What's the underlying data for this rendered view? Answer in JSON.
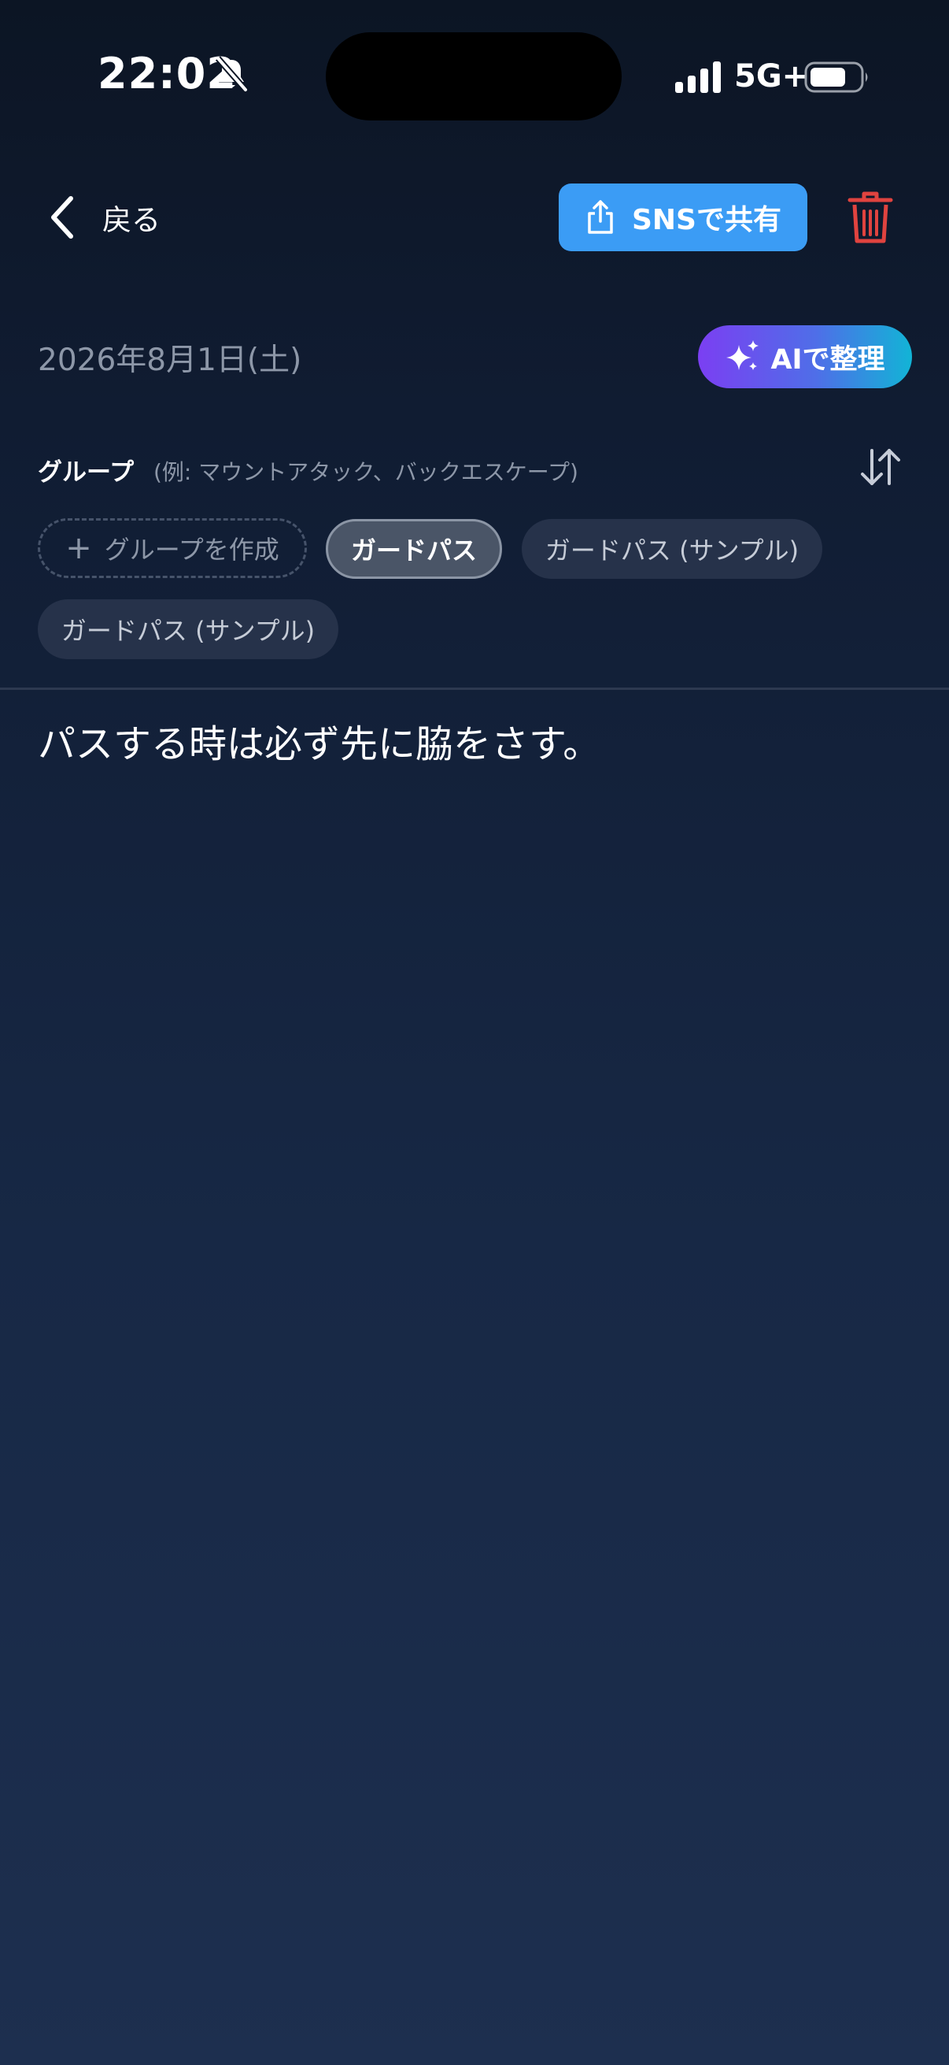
{
  "status_bar": {
    "time": "22:02",
    "network": "5G+",
    "icons": [
      "bell-slash-icon",
      "signal-icon",
      "battery-icon"
    ]
  },
  "header": {
    "back_label": "戻る",
    "share_label": "SNSで共有",
    "icons": [
      "chevron-left-icon",
      "share-icon",
      "trash-icon"
    ]
  },
  "date": "2026年8月1日(土)",
  "ai_button": {
    "label": "AIで整理",
    "icon": "sparkles-icon"
  },
  "groups": {
    "title": "グループ",
    "hint": "(例: マウントアタック、バックエスケープ)",
    "create_label": "グループを作成",
    "chips": [
      {
        "label": "ガードパス",
        "selected": true
      },
      {
        "label": "ガードパス (サンプル)",
        "selected": false
      },
      {
        "label": "ガードパス (サンプル)",
        "selected": false
      }
    ],
    "sort_icon": "sort-arrows-icon"
  },
  "note": {
    "body": "パスする時は必ず先に脇をさす。"
  },
  "colors": {
    "share_button": "#3b9cf5",
    "trash": "#e0433f",
    "ai_gradient_start": "#7b3ff2",
    "ai_gradient_end": "#12b4d6",
    "background_top": "#0c1524",
    "background_bottom": "#1d2f4f"
  }
}
